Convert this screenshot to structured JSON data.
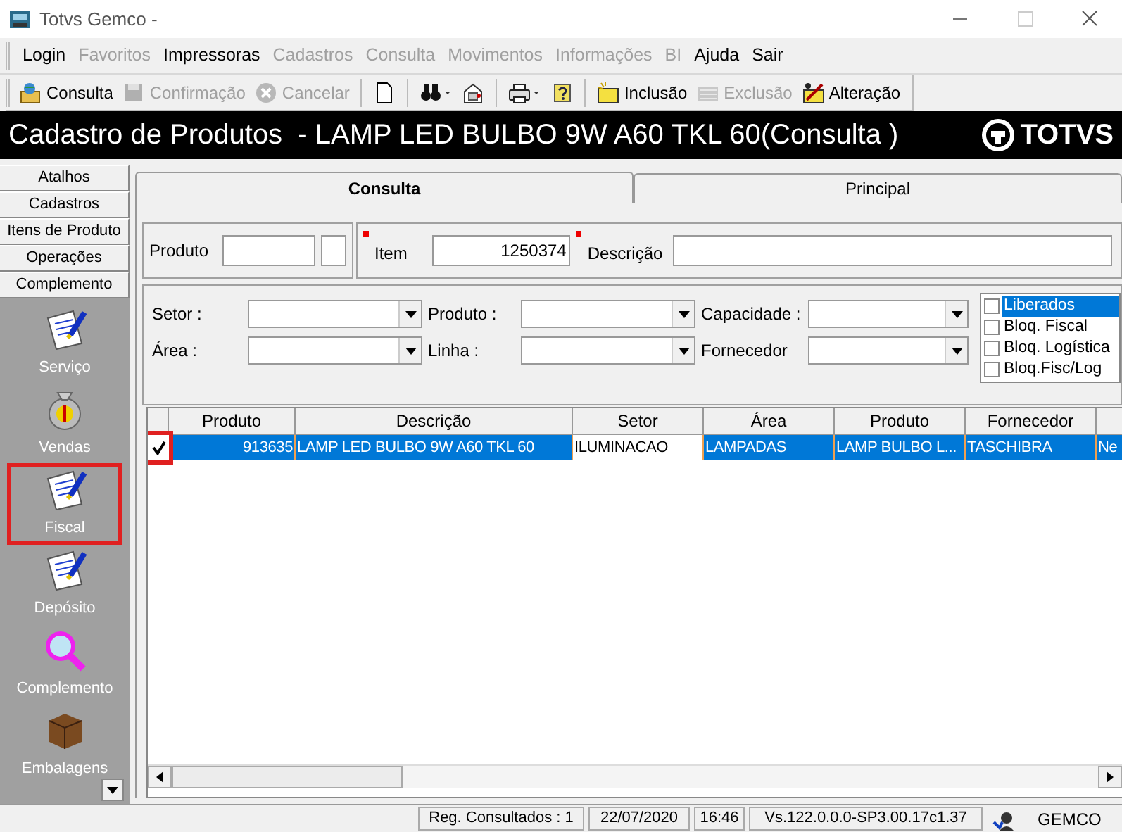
{
  "window": {
    "title": "Totvs Gemco -"
  },
  "menu": [
    {
      "label": "Login",
      "disabled": false
    },
    {
      "label": "Favoritos",
      "disabled": true
    },
    {
      "label": "Impressoras",
      "disabled": false
    },
    {
      "label": "Cadastros",
      "disabled": true
    },
    {
      "label": "Consulta",
      "disabled": true
    },
    {
      "label": "Movimentos",
      "disabled": true
    },
    {
      "label": "Informações",
      "disabled": true
    },
    {
      "label": "BI",
      "disabled": true
    },
    {
      "label": "Ajuda",
      "disabled": false
    },
    {
      "label": "Sair",
      "disabled": false
    }
  ],
  "toolbar": [
    {
      "kind": "open",
      "label": "Consulta",
      "disabled": false
    },
    {
      "kind": "save",
      "label": "Confirmação",
      "disabled": true
    },
    {
      "kind": "cancel",
      "label": "Cancelar",
      "disabled": true
    },
    {
      "kind": "sep"
    },
    {
      "kind": "page"
    },
    {
      "kind": "sep"
    },
    {
      "kind": "binoculars"
    },
    {
      "kind": "mail"
    },
    {
      "kind": "sep"
    },
    {
      "kind": "printer"
    },
    {
      "kind": "help"
    },
    {
      "kind": "sep"
    },
    {
      "kind": "new",
      "label": "Inclusão",
      "disabled": false
    },
    {
      "kind": "delete",
      "label": "Exclusão",
      "disabled": true
    },
    {
      "kind": "edit",
      "label": "Alteração",
      "disabled": false
    }
  ],
  "header": {
    "title": "Cadastro de Produtos  - LAMP LED BULBO 9W A60 TKL 60(Consulta )",
    "logo": "TOTVS"
  },
  "sidebar": {
    "sections": [
      "Atalhos",
      "Cadastros",
      "Itens de Produto",
      "Operações",
      "Complemento"
    ],
    "shortcuts": [
      {
        "kind": "document",
        "label": "Serviço",
        "highlighted": false
      },
      {
        "kind": "money",
        "label": "Vendas",
        "highlighted": false
      },
      {
        "kind": "document",
        "label": "Fiscal",
        "highlighted": true
      },
      {
        "kind": "document",
        "label": "Depósito",
        "highlighted": false
      },
      {
        "kind": "magnifier",
        "label": "Complemento",
        "highlighted": false
      },
      {
        "kind": "box",
        "label": "Embalagens",
        "highlighted": false
      }
    ]
  },
  "tabs": [
    {
      "label": "Consulta",
      "selected": true
    },
    {
      "label": "Principal",
      "selected": false
    }
  ],
  "fields": {
    "produto_label": "Produto",
    "item_label": "Item",
    "item_value": "1250374",
    "descricao_label": "Descrição"
  },
  "filters": [
    {
      "label": "Setor :"
    },
    {
      "label": "Produto :"
    },
    {
      "label": "Capacidade :"
    },
    {
      "label": "Área :"
    },
    {
      "label": "Linha :"
    },
    {
      "label": "Fornecedor"
    }
  ],
  "status_options": [
    {
      "label": "Liberados",
      "checked": false,
      "selected": true
    },
    {
      "label": "Bloq. Fiscal",
      "checked": false,
      "selected": false
    },
    {
      "label": "Bloq. Logística",
      "checked": false,
      "selected": false
    },
    {
      "label": "Bloq.Fisc/Log",
      "checked": false,
      "selected": false
    }
  ],
  "table": {
    "columns": [
      "Produto",
      "Descrição",
      "Setor",
      "Área",
      "Produto",
      "Fornecedor"
    ],
    "rows": [
      {
        "checked": true,
        "highlighted": true,
        "selected": true,
        "cells": [
          {
            "text": "913635",
            "focused": false
          },
          {
            "text": "LAMP LED BULBO 9W A60 TKL 60",
            "focused": false
          },
          {
            "text": "ILUMINACAO",
            "focused": true
          },
          {
            "text": "LAMPADAS",
            "focused": false
          },
          {
            "text": "LAMP BULBO L...",
            "focused": false
          },
          {
            "text": "TASCHIBRA",
            "focused": false
          },
          {
            "text": "Ne",
            "focused": false
          }
        ]
      }
    ]
  },
  "status_bar": [
    "Reg. Consultados : 1",
    "22/07/2020",
    "16:46",
    "Vs.122.0.0.0-SP3.00.17c1.37",
    "GEMCO"
  ]
}
